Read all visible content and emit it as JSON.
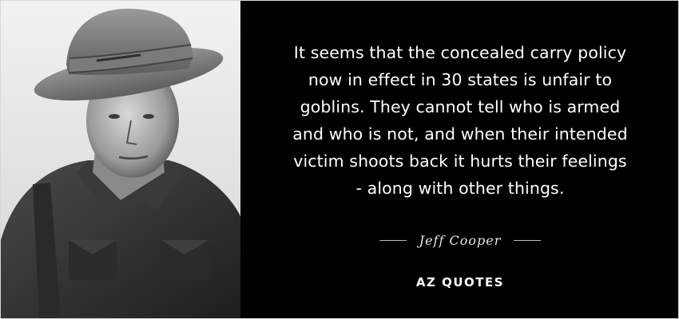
{
  "quote": {
    "lines": [
      "It seems that the concealed carry policy",
      "now in effect in 30 states is unfair to",
      "goblins. They cannot tell who is armed",
      "and who is not, and when their intended",
      "victim shoots back it hurts their feelings",
      "- along with other things."
    ]
  },
  "author": {
    "name": "Jeff Cooper"
  },
  "brand": {
    "name": "AZ QUOTES"
  },
  "photo": {
    "description_icon": "portrait-photo"
  },
  "colors": {
    "background": "#000000",
    "text": "#ffffff",
    "divider": "#bdbdbd"
  }
}
